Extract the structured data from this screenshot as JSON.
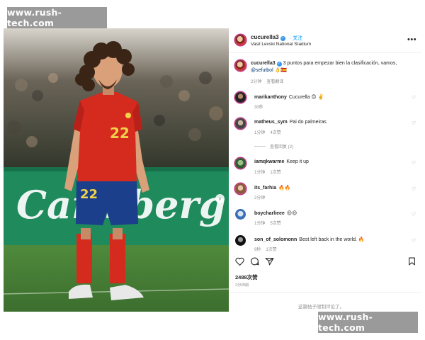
{
  "watermark": {
    "top": "www.rush-tech.com",
    "bottom": "www.rush-tech.com"
  },
  "post": {
    "username": "cucurella3",
    "follow_label": "· 关注",
    "location": "Vasil Levski National Stadium",
    "more_label": "•••",
    "caption": {
      "username": "cucurella3",
      "text": "3 puntos para empezar bien la clasificación, vamos,",
      "mention": "@sefutbol",
      "emojis": "👌🇪🇸",
      "age": "2分钟",
      "translate_label": "查看翻译"
    },
    "photo": {
      "jersey_number": "22",
      "banner_text": "Carlsberg"
    },
    "likes": "2488次赞",
    "posted_ago": "2分钟前",
    "comments_disabled": "这篇帖子限制评论了。"
  },
  "colors": {
    "link": "#00376b",
    "verified": "#3897f0",
    "follow": "#0095f6",
    "jersey": "#d52b1e"
  },
  "comments": [
    {
      "username": "marikanthony",
      "text": "Cucurella 😊 ✌️",
      "age": "30秒",
      "likes": "",
      "replies": ""
    },
    {
      "username": "matheus_sym",
      "text": "Pai do palmeiras",
      "age": "1分钟",
      "likes": "4次赞",
      "replies": "查看回复 (2)"
    },
    {
      "username": "iamqkwarme",
      "text": "Keep it up",
      "age": "1分钟",
      "likes": "1次赞",
      "replies": ""
    },
    {
      "username": "its_farhia",
      "text": "🔥🔥",
      "age": "2分钟",
      "likes": "",
      "replies": ""
    },
    {
      "username": "boycharlieee",
      "text": "😍😍",
      "age": "1分钟",
      "likes": "5次赞",
      "replies": ""
    },
    {
      "username": "son_of_solomonn",
      "text": "Best left back in the world. 🔥",
      "age": "9秒",
      "likes": "1次赞",
      "replies": ""
    }
  ],
  "icons": {
    "heart": "heart-icon",
    "comment": "comment-icon",
    "share": "share-icon",
    "save": "bookmark-icon",
    "verified": "verified-badge-icon",
    "more": "more-options-icon"
  }
}
